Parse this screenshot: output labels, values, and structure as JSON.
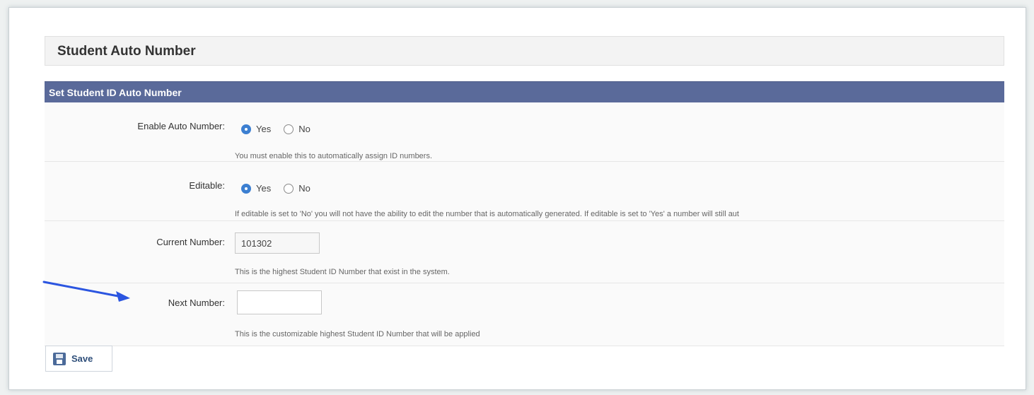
{
  "page": {
    "title": "Student Auto Number"
  },
  "section": {
    "title": "Set Student ID Auto Number"
  },
  "fields": {
    "enable_auto_number": {
      "label": "Enable Auto Number:",
      "options": [
        "Yes",
        "No"
      ],
      "selected": "Yes",
      "help": "You must enable this to automatically assign ID numbers."
    },
    "editable": {
      "label": "Editable:",
      "options": [
        "Yes",
        "No"
      ],
      "selected": "Yes",
      "help": "If editable is set to 'No' you will not have the ability to edit the number that is automatically generated. If editable is set to 'Yes' a number will still aut"
    },
    "current_number": {
      "label": "Current Number:",
      "value": "101302",
      "help": "This is the highest Student ID Number that exist in the system."
    },
    "next_number": {
      "label": "Next Number:",
      "value": "",
      "help": "This is the customizable highest Student ID Number that will be applied"
    }
  },
  "actions": {
    "save_label": "Save"
  },
  "icons": {
    "save": "save-icon",
    "annotation": "arrow-icon"
  },
  "colors": {
    "section_bar": "#5a6a9a",
    "radio_checked": "#3c7fd1",
    "arrow": "#2b55e0"
  }
}
